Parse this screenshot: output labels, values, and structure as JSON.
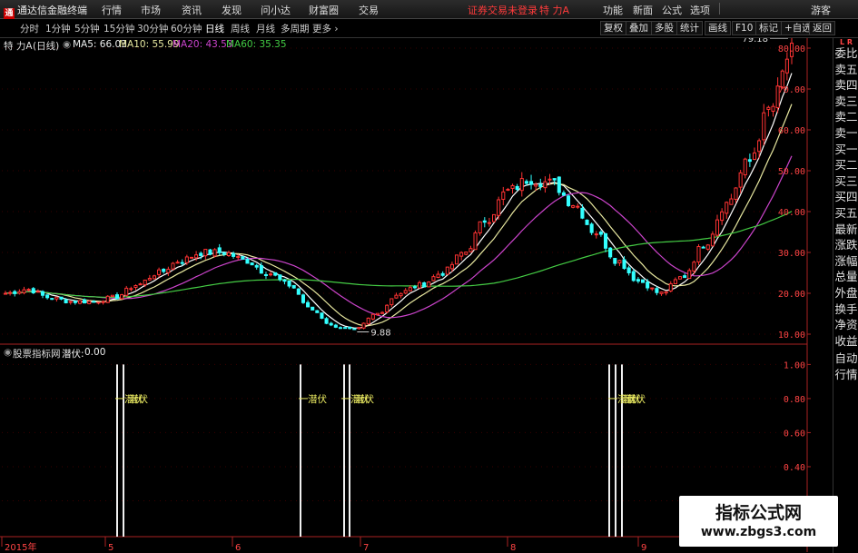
{
  "app": {
    "title": "通达信金融终端"
  },
  "menu": [
    "行情",
    "市场",
    "资讯",
    "发现",
    "问小达",
    "财富圈",
    "交易"
  ],
  "status": {
    "notice": "证券交易未登录",
    "stock": "特 力A"
  },
  "right_menu": [
    "功能",
    "新面",
    "公式",
    "选项",
    "游客"
  ],
  "period_tabs": [
    "分时",
    "1分钟",
    "5分钟",
    "15分钟",
    "30分钟",
    "60分钟",
    "日线",
    "周线",
    "月线",
    "多周期",
    "更多"
  ],
  "active_period": "日线",
  "right_tools": [
    "复权",
    "叠加",
    "多股",
    "统计",
    "画线",
    "F10",
    "标记",
    "+自选",
    "返回"
  ],
  "info": {
    "stock_name": "特 力A",
    "period": "(日线)",
    "ma5": "MA5: 66.03",
    "ma10": "MA10: 55.99",
    "ma20": "MA20: 43.53",
    "ma60": "MA60: 35.35"
  },
  "indicator": {
    "source": "股票指标网",
    "name": "潜伏:",
    "value": "0.00"
  },
  "colors": {
    "ma5": "#ffffff",
    "ma10": "#e8e8a0",
    "ma20": "#cc44cc",
    "ma60": "#44cc44",
    "up": "#ff3333",
    "down": "#33ffff",
    "axis": "#aa2222",
    "accent": "#ff4444"
  },
  "sidebar": {
    "badge": "L R",
    "items": [
      "委比",
      "卖五",
      "卖四",
      "卖三",
      "卖二",
      "卖一",
      "买一",
      "买二",
      "买三",
      "买四",
      "买五",
      "最新",
      "涨跌",
      "涨幅",
      "总量",
      "外盘",
      "换手",
      "净资",
      "收益"
    ],
    "bottom": [
      "自动",
      "行情"
    ]
  },
  "chart_data": {
    "type": "candlestick",
    "price_axis": {
      "ylim": [
        8,
        82
      ],
      "ticks": [
        "80.00",
        "70.00",
        "60.00",
        "50.00",
        "40.00",
        "30.00",
        "20.00",
        "10.00"
      ]
    },
    "indicator_axis": {
      "ylim": [
        0,
        1.05
      ],
      "ticks": [
        "1.00",
        "0.80",
        "0.60",
        "0.40",
        "0.20"
      ]
    },
    "x_labels": [
      "2015年",
      "5",
      "6",
      "7",
      "8",
      "9"
    ],
    "annotations": {
      "high": "79.18",
      "low": "9.88"
    },
    "signal_label": "潜伏",
    "signal_groups": [
      {
        "bars": [
          0,
          1
        ],
        "labels": 2
      },
      {
        "bars": [
          2
        ],
        "labels": 1
      },
      {
        "bars": [
          3,
          4
        ],
        "labels": 2
      },
      {
        "bars": [
          5,
          6,
          7
        ],
        "labels": 3
      }
    ],
    "price_key": [
      20,
      21,
      19,
      18,
      18,
      19,
      22,
      25,
      28,
      30,
      30,
      28,
      25,
      22,
      16,
      12,
      11,
      15,
      20,
      22,
      25,
      30,
      38,
      45,
      48,
      47,
      42,
      35,
      28,
      23,
      20,
      24,
      32,
      42,
      52,
      65,
      79
    ]
  },
  "watermark": {
    "line1": "指标公式网",
    "line2": "www.zbgs3.com"
  }
}
